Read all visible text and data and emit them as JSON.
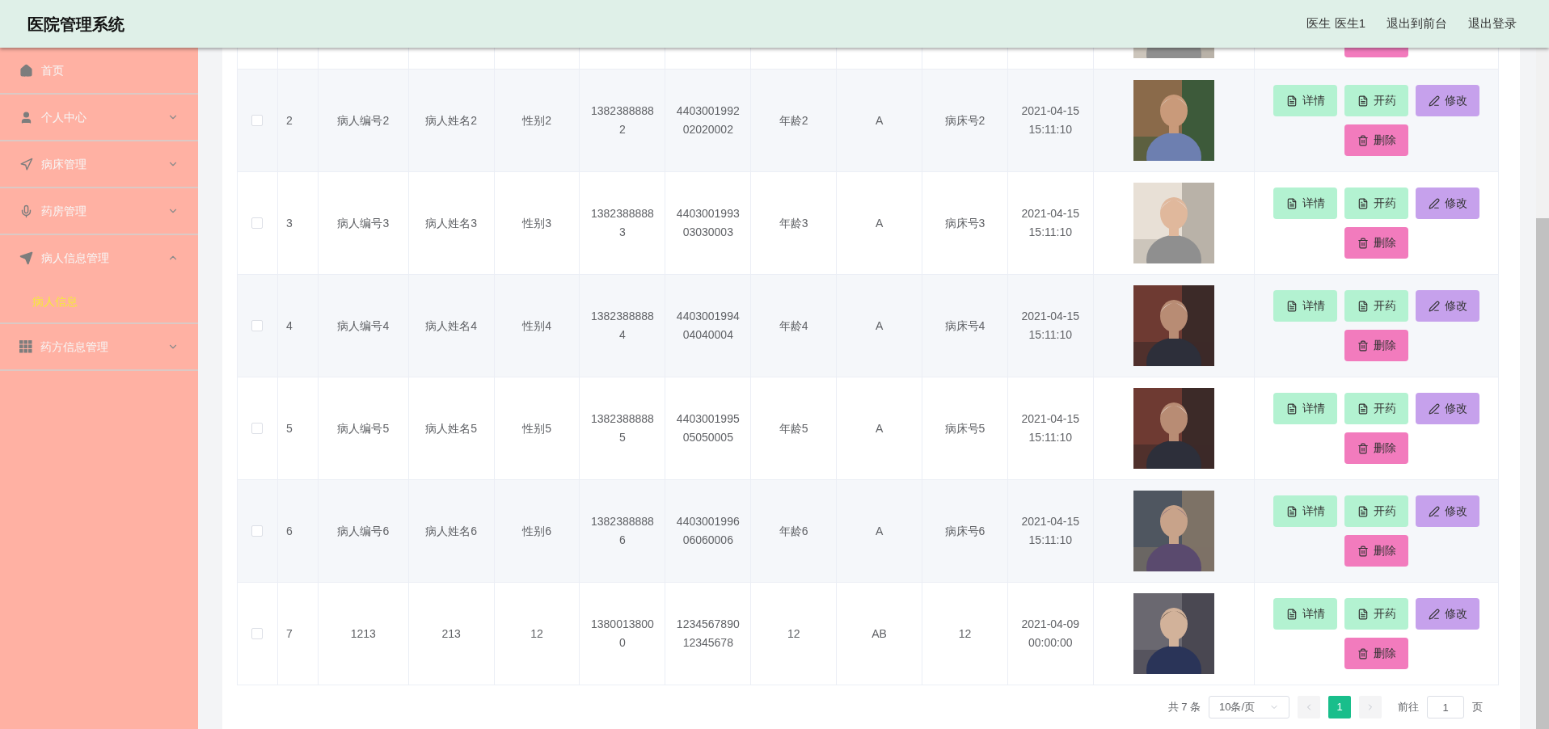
{
  "header": {
    "title": "医院管理系统",
    "user": "医生 医生1",
    "links": [
      "退出到前台",
      "退出登录"
    ]
  },
  "sidebar": {
    "items": [
      {
        "label": "首页"
      },
      {
        "label": "个人中心",
        "expanded": false
      },
      {
        "label": "病床管理",
        "expanded": false
      },
      {
        "label": "药房管理",
        "expanded": false
      },
      {
        "label": "病人信息管理",
        "expanded": true,
        "children": [
          {
            "label": "病人信息",
            "selected": true
          }
        ]
      },
      {
        "label": "药方信息管理",
        "expanded": false
      }
    ]
  },
  "table": {
    "rows": [
      {
        "checked": false,
        "cells": [
          "2",
          "病人编号2",
          "病人姓名2",
          "性别2",
          "13823888882",
          "440300199202020002",
          "年龄2",
          "A",
          "病床号2",
          "2021-04-15 15:11:10"
        ],
        "actions": [
          {
            "label": "详情",
            "kind": "detail"
          },
          {
            "label": "开药",
            "kind": "prescribe"
          },
          {
            "label": "修改",
            "kind": "edit"
          },
          {
            "label": "删除",
            "kind": "delete"
          }
        ]
      },
      {
        "checked": false,
        "cells": [
          "3",
          "病人编号3",
          "病人姓名3",
          "性别3",
          "13823888883",
          "440300199303030003",
          "年龄3",
          "A",
          "病床号3",
          "2021-04-15 15:11:10"
        ],
        "actions": [
          {
            "label": "详情",
            "kind": "detail"
          },
          {
            "label": "开药",
            "kind": "prescribe"
          },
          {
            "label": "修改",
            "kind": "edit"
          },
          {
            "label": "删除",
            "kind": "delete"
          }
        ]
      },
      {
        "checked": false,
        "cells": [
          "4",
          "病人编号4",
          "病人姓名4",
          "性别4",
          "13823888884",
          "440300199404040004",
          "年龄4",
          "A",
          "病床号4",
          "2021-04-15 15:11:10"
        ],
        "actions": [
          {
            "label": "详情",
            "kind": "detail"
          },
          {
            "label": "开药",
            "kind": "prescribe"
          },
          {
            "label": "修改",
            "kind": "edit"
          },
          {
            "label": "删除",
            "kind": "delete"
          }
        ]
      },
      {
        "checked": false,
        "cells": [
          "5",
          "病人编号5",
          "病人姓名5",
          "性别5",
          "13823888885",
          "440300199505050005",
          "年龄5",
          "A",
          "病床号5",
          "2021-04-15 15:11:10"
        ],
        "actions": [
          {
            "label": "详情",
            "kind": "detail"
          },
          {
            "label": "开药",
            "kind": "prescribe"
          },
          {
            "label": "修改",
            "kind": "edit"
          },
          {
            "label": "删除",
            "kind": "delete"
          }
        ]
      },
      {
        "checked": false,
        "cells": [
          "6",
          "病人编号6",
          "病人姓名6",
          "性别6",
          "13823888886",
          "440300199606060006",
          "年龄6",
          "A",
          "病床号6",
          "2021-04-15 15:11:10"
        ],
        "actions": [
          {
            "label": "详情",
            "kind": "detail"
          },
          {
            "label": "开药",
            "kind": "prescribe"
          },
          {
            "label": "修改",
            "kind": "edit"
          },
          {
            "label": "删除",
            "kind": "delete"
          }
        ]
      },
      {
        "checked": false,
        "cells": [
          "7",
          "1213",
          "213",
          "12",
          "13800138000",
          "123456789012345678",
          "12",
          "AB",
          "12",
          "2021-04-09 00:00:00"
        ],
        "actions": [
          {
            "label": "详情",
            "kind": "detail"
          },
          {
            "label": "开药",
            "kind": "prescribe"
          },
          {
            "label": "修改",
            "kind": "edit"
          },
          {
            "label": "删除",
            "kind": "delete"
          }
        ]
      }
    ]
  },
  "pagination": {
    "total": "共 7 条",
    "page_size": "10条/页",
    "pages": [
      {
        "label": "1",
        "selected": true
      }
    ],
    "goto_label": "前往",
    "goto_value": "1",
    "goto_suffix": "页"
  }
}
